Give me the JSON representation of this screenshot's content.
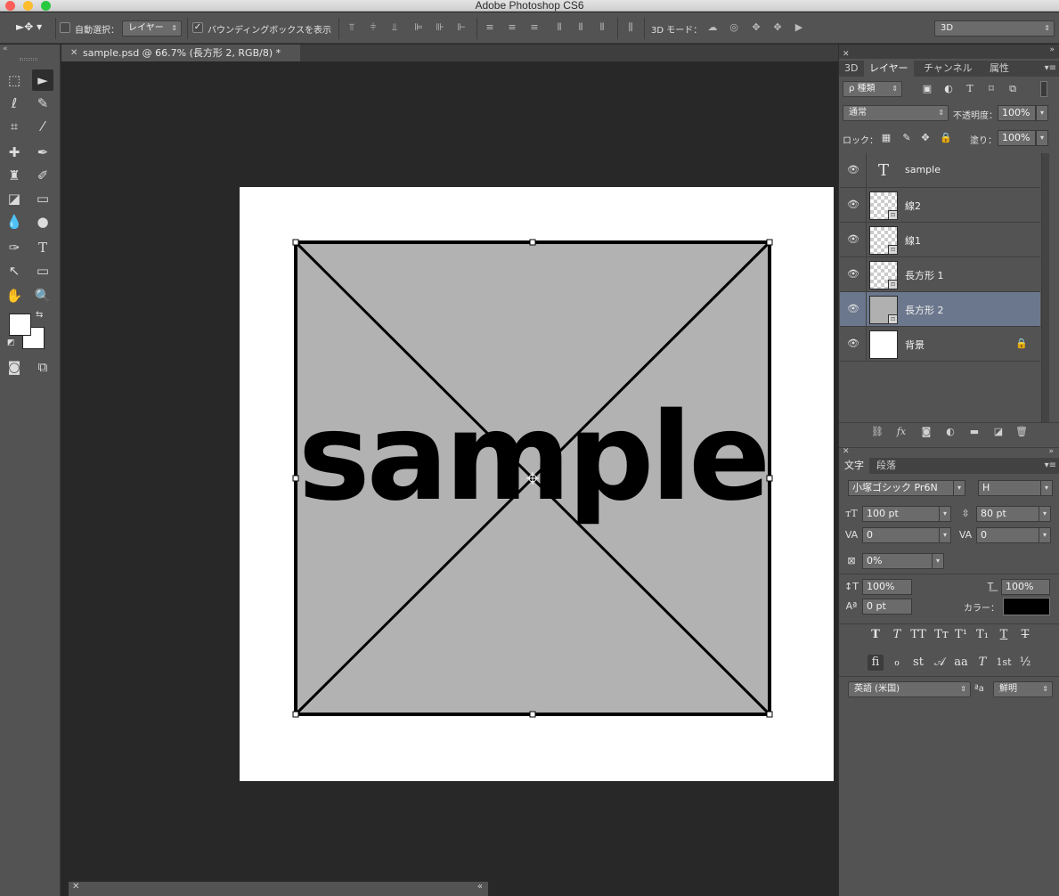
{
  "app": {
    "title": "Adobe Photoshop CS6"
  },
  "options_bar": {
    "auto_select_label": "自動選択：",
    "auto_select_value": "レイヤー",
    "bounding_box_label": "バウンディングボックスを表示",
    "mode_3d_label": "3D モード：",
    "workspace_value": "3D"
  },
  "document": {
    "tab_label": "sample.psd @ 66.7% (長方形 2, RGB/8) *",
    "canvas_text": "sample"
  },
  "layers_panel": {
    "tabs": [
      "3D",
      "レイヤー",
      "チャンネル",
      "属性"
    ],
    "filter_label": "ρ 種類",
    "blend_mode": "通常",
    "opacity_label": "不透明度：",
    "opacity_value": "100%",
    "lock_label": "ロック：",
    "fill_label": "塗り：",
    "fill_value": "100%",
    "layers": [
      {
        "name": "sample",
        "thumb": "text",
        "selected": false
      },
      {
        "name": "線2",
        "thumb": "checker",
        "selected": false
      },
      {
        "name": "線1",
        "thumb": "checker",
        "selected": false
      },
      {
        "name": "長方形 1",
        "thumb": "checker",
        "selected": false
      },
      {
        "name": "長方形 2",
        "thumb": "gray",
        "selected": true
      },
      {
        "name": "背景",
        "thumb": "white",
        "selected": false
      }
    ]
  },
  "character_panel": {
    "tabs": [
      "文字",
      "段落"
    ],
    "font_family": "小塚ゴシック Pr6N",
    "font_style": "H",
    "font_size": "100 pt",
    "leading": "80 pt",
    "kerning": "0",
    "tracking": "0",
    "tsume": "0%",
    "vertical_scale": "100%",
    "horizontal_scale": "100%",
    "baseline_shift": "0 pt",
    "color_label": "カラー：",
    "color_value": "#000000",
    "language": "英語 (米国)",
    "antialias_label": "ªa",
    "antialias": "鮮明",
    "style_buttons_1": [
      "T",
      "T",
      "TT",
      "Tт",
      "T¹",
      "T₁",
      "T",
      "T"
    ],
    "style_buttons_2": [
      "ﬁ",
      "ℴ",
      "st",
      "𝒜",
      "aa",
      "T",
      "1st",
      "½"
    ]
  }
}
